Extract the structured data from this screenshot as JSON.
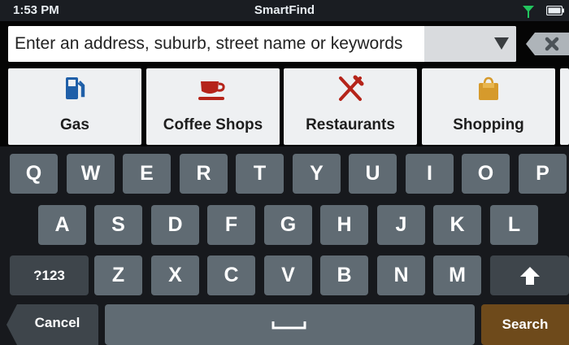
{
  "status_bar": {
    "time": "1:53 PM",
    "title": "SmartFind"
  },
  "search": {
    "placeholder": "Enter an address, suburb, street name or keywords"
  },
  "categories": [
    {
      "label": "Gas",
      "icon": "gas-pump-icon",
      "icon_color": "#1f5fa8"
    },
    {
      "label": "Coffee Shops",
      "icon": "coffee-cup-icon",
      "icon_color": "#b5241a"
    },
    {
      "label": "Restaurants",
      "icon": "fork-knife-icon",
      "icon_color": "#b5241a"
    },
    {
      "label": "Shopping",
      "icon": "shopping-bag-icon",
      "icon_color": "#d69a2c"
    }
  ],
  "keyboard": {
    "row1": [
      "Q",
      "W",
      "E",
      "R",
      "T",
      "Y",
      "U",
      "I",
      "O",
      "P"
    ],
    "row2": [
      "A",
      "S",
      "D",
      "F",
      "G",
      "H",
      "J",
      "K",
      "L"
    ],
    "row3": [
      "Z",
      "X",
      "C",
      "V",
      "B",
      "N",
      "M"
    ],
    "numbers_label": "?123",
    "cancel_label": "Cancel",
    "search_label": "Search"
  },
  "colors": {
    "key": "#606b73",
    "key_dark": "#3e454b",
    "search_accent": "#6e4a1b",
    "signal": "#22c55e"
  }
}
